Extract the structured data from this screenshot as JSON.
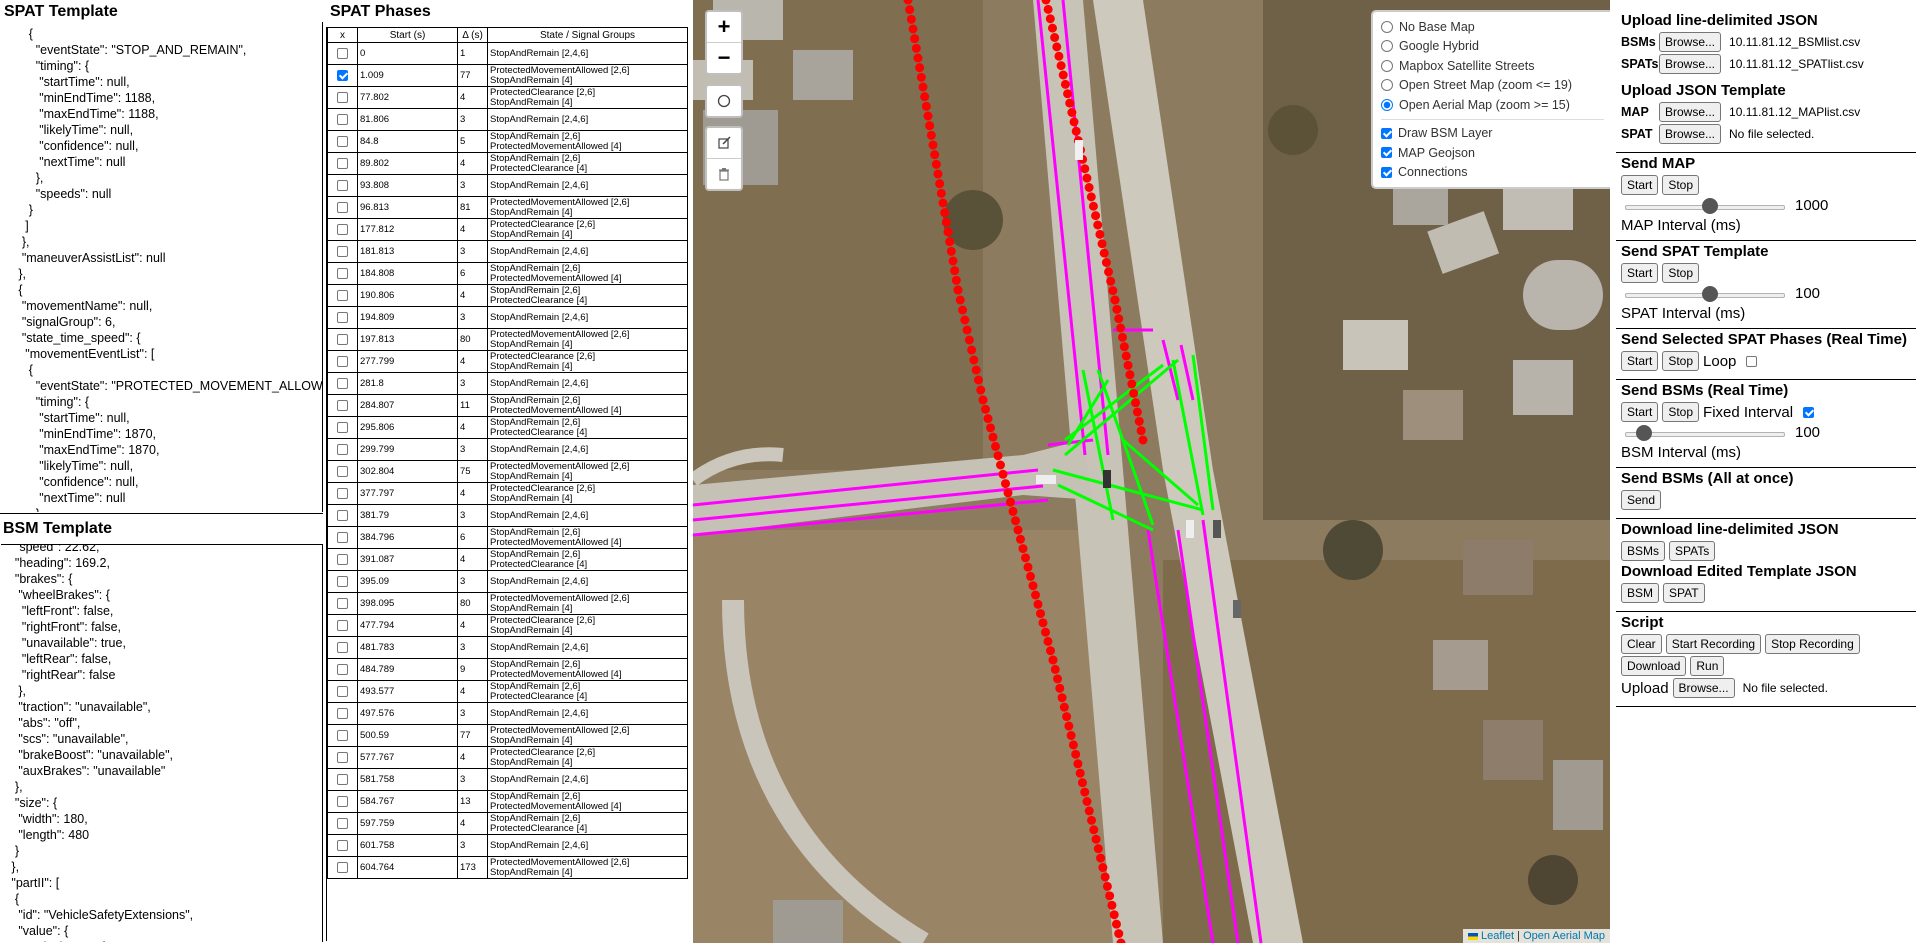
{
  "spat_template": {
    "title": "SPAT Template",
    "code": "        {\n          \"eventState\": \"STOP_AND_REMAIN\",\n          \"timing\": {\n           \"startTime\": null,\n           \"minEndTime\": 1188,\n           \"maxEndTime\": 1188,\n           \"likelyTime\": null,\n           \"confidence\": null,\n           \"nextTime\": null\n          },\n          \"speeds\": null\n        }\n       ]\n      },\n      \"maneuverAssistList\": null\n     },\n     {\n      \"movementName\": null,\n      \"signalGroup\": 6,\n      \"state_time_speed\": {\n       \"movementEventList\": [\n        {\n          \"eventState\": \"PROTECTED_MOVEMENT_ALLOWED\",\n          \"timing\": {\n           \"startTime\": null,\n           \"minEndTime\": 1870,\n           \"maxEndTime\": 1870,\n           \"likelyTime\": null,\n           \"confidence\": null,\n           \"nextTime\": null\n          },"
  },
  "bsm_template": {
    "title": "BSM Template",
    "code": "    \"speed\": 22.62,\n    \"heading\": 169.2,\n    \"brakes\": {\n     \"wheelBrakes\": {\n      \"leftFront\": false,\n      \"rightFront\": false,\n      \"unavailable\": true,\n      \"leftRear\": false,\n      \"rightRear\": false\n     },\n     \"traction\": \"unavailable\",\n     \"abs\": \"off\",\n     \"scs\": \"unavailable\",\n     \"brakeBoost\": \"unavailable\",\n     \"auxBrakes\": \"unavailable\"\n    },\n    \"size\": {\n     \"width\": 180,\n     \"length\": 480\n    }\n   },\n   \"partII\": [\n    {\n     \"id\": \"VehicleSafetyExtensions\",\n     \"value\": {\n      \"pathHistory\": {"
  },
  "spat_phases": {
    "title": "SPAT Phases",
    "headers": [
      "x",
      "Start (s)",
      "Δ (s)",
      "State / Signal Groups"
    ],
    "rows": [
      {
        "checked": false,
        "start": "0",
        "delta": "1",
        "state": "StopAndRemain [2,4,6]"
      },
      {
        "checked": true,
        "start": "1.009",
        "delta": "77",
        "state": "ProtectedMovementAllowed [2,6]\nStopAndRemain [4]"
      },
      {
        "checked": false,
        "start": "77.802",
        "delta": "4",
        "state": "ProtectedClearance [2,6]\nStopAndRemain [4]"
      },
      {
        "checked": false,
        "start": "81.806",
        "delta": "3",
        "state": "StopAndRemain [2,4,6]"
      },
      {
        "checked": false,
        "start": "84.8",
        "delta": "5",
        "state": "StopAndRemain [2,6]\nProtectedMovementAllowed [4]"
      },
      {
        "checked": false,
        "start": "89.802",
        "delta": "4",
        "state": "StopAndRemain [2,6]\nProtectedClearance [4]"
      },
      {
        "checked": false,
        "start": "93.808",
        "delta": "3",
        "state": "StopAndRemain [2,4,6]"
      },
      {
        "checked": false,
        "start": "96.813",
        "delta": "81",
        "state": "ProtectedMovementAllowed [2,6]\nStopAndRemain [4]"
      },
      {
        "checked": false,
        "start": "177.812",
        "delta": "4",
        "state": "ProtectedClearance [2,6]\nStopAndRemain [4]"
      },
      {
        "checked": false,
        "start": "181.813",
        "delta": "3",
        "state": "StopAndRemain [2,4,6]"
      },
      {
        "checked": false,
        "start": "184.808",
        "delta": "6",
        "state": "StopAndRemain [2,6]\nProtectedMovementAllowed [4]"
      },
      {
        "checked": false,
        "start": "190.806",
        "delta": "4",
        "state": "StopAndRemain [2,6]\nProtectedClearance [4]"
      },
      {
        "checked": false,
        "start": "194.809",
        "delta": "3",
        "state": "StopAndRemain [2,4,6]"
      },
      {
        "checked": false,
        "start": "197.813",
        "delta": "80",
        "state": "ProtectedMovementAllowed [2,6]\nStopAndRemain [4]"
      },
      {
        "checked": false,
        "start": "277.799",
        "delta": "4",
        "state": "ProtectedClearance [2,6]\nStopAndRemain [4]"
      },
      {
        "checked": false,
        "start": "281.8",
        "delta": "3",
        "state": "StopAndRemain [2,4,6]"
      },
      {
        "checked": false,
        "start": "284.807",
        "delta": "11",
        "state": "StopAndRemain [2,6]\nProtectedMovementAllowed [4]"
      },
      {
        "checked": false,
        "start": "295.806",
        "delta": "4",
        "state": "StopAndRemain [2,6]\nProtectedClearance [4]"
      },
      {
        "checked": false,
        "start": "299.799",
        "delta": "3",
        "state": "StopAndRemain [2,4,6]"
      },
      {
        "checked": false,
        "start": "302.804",
        "delta": "75",
        "state": "ProtectedMovementAllowed [2,6]\nStopAndRemain [4]"
      },
      {
        "checked": false,
        "start": "377.797",
        "delta": "4",
        "state": "ProtectedClearance [2,6]\nStopAndRemain [4]"
      },
      {
        "checked": false,
        "start": "381.79",
        "delta": "3",
        "state": "StopAndRemain [2,4,6]"
      },
      {
        "checked": false,
        "start": "384.796",
        "delta": "6",
        "state": "StopAndRemain [2,6]\nProtectedMovementAllowed [4]"
      },
      {
        "checked": false,
        "start": "391.087",
        "delta": "4",
        "state": "StopAndRemain [2,6]\nProtectedClearance [4]"
      },
      {
        "checked": false,
        "start": "395.09",
        "delta": "3",
        "state": "StopAndRemain [2,4,6]"
      },
      {
        "checked": false,
        "start": "398.095",
        "delta": "80",
        "state": "ProtectedMovementAllowed [2,6]\nStopAndRemain [4]"
      },
      {
        "checked": false,
        "start": "477.794",
        "delta": "4",
        "state": "ProtectedClearance [2,6]\nStopAndRemain [4]"
      },
      {
        "checked": false,
        "start": "481.783",
        "delta": "3",
        "state": "StopAndRemain [2,4,6]"
      },
      {
        "checked": false,
        "start": "484.789",
        "delta": "9",
        "state": "StopAndRemain [2,6]\nProtectedMovementAllowed [4]"
      },
      {
        "checked": false,
        "start": "493.577",
        "delta": "4",
        "state": "StopAndRemain [2,6]\nProtectedClearance [4]"
      },
      {
        "checked": false,
        "start": "497.576",
        "delta": "3",
        "state": "StopAndRemain [2,4,6]"
      },
      {
        "checked": false,
        "start": "500.59",
        "delta": "77",
        "state": "ProtectedMovementAllowed [2,6]\nStopAndRemain [4]"
      },
      {
        "checked": false,
        "start": "577.767",
        "delta": "4",
        "state": "ProtectedClearance [2,6]\nStopAndRemain [4]"
      },
      {
        "checked": false,
        "start": "581.758",
        "delta": "3",
        "state": "StopAndRemain [2,4,6]"
      },
      {
        "checked": false,
        "start": "584.767",
        "delta": "13",
        "state": "StopAndRemain [2,6]\nProtectedMovementAllowed [4]"
      },
      {
        "checked": false,
        "start": "597.759",
        "delta": "4",
        "state": "StopAndRemain [2,6]\nProtectedClearance [4]"
      },
      {
        "checked": false,
        "start": "601.758",
        "delta": "3",
        "state": "StopAndRemain [2,4,6]"
      },
      {
        "checked": false,
        "start": "604.764",
        "delta": "173",
        "state": "ProtectedMovementAllowed [2,6]\nStopAndRemain [4]"
      }
    ]
  },
  "map": {
    "zoom_in": "+",
    "zoom_out": "−",
    "base_layers": [
      {
        "label": "No Base Map",
        "selected": false
      },
      {
        "label": "Google Hybrid",
        "selected": false
      },
      {
        "label": "Mapbox Satellite Streets",
        "selected": false
      },
      {
        "label": "Open Street Map (zoom <= 19)",
        "selected": false
      },
      {
        "label": "Open Aerial Map (zoom >= 15)",
        "selected": true
      }
    ],
    "overlays": [
      {
        "label": "Draw BSM Layer",
        "checked": true
      },
      {
        "label": "MAP Geojson",
        "checked": true
      },
      {
        "label": "Connections",
        "checked": true
      }
    ],
    "attribution_leaflet": "Leaflet",
    "attribution_sep": " | ",
    "attribution_source": "Open Aerial Map",
    "colors": {
      "bsm": "#ff0000",
      "lanes": "#ff00ff",
      "connections": "#00ff00"
    }
  },
  "panel": {
    "upload_json": {
      "title": "Upload line-delimited JSON",
      "bsms_label": "BSMs",
      "bsms_file": "10.11.81.12_BSMlist.csv",
      "spats_label": "SPATs",
      "spats_file": "10.11.81.12_SPATlist.csv",
      "browse": "Browse..."
    },
    "upload_template": {
      "title": "Upload JSON Template",
      "map_label": "MAP",
      "map_file": "10.11.81.12_MAPlist.csv",
      "spat_label": "SPAT",
      "spat_file": "No file selected.",
      "browse": "Browse..."
    },
    "send_map": {
      "title": "Send MAP",
      "start": "Start",
      "stop": "Stop",
      "value": "1000",
      "value_pct": 53,
      "interval_label": "MAP Interval (ms)"
    },
    "send_spat_template": {
      "title": "Send SPAT Template",
      "start": "Start",
      "stop": "Stop",
      "value": "100",
      "value_pct": 53,
      "interval_label": "SPAT Interval (ms)"
    },
    "send_selected": {
      "title": "Send Selected SPAT Phases (Real Time)",
      "start": "Start",
      "stop": "Stop",
      "loop_label": "Loop",
      "loop_checked": false
    },
    "send_bsms_rt": {
      "title": "Send BSMs (Real Time)",
      "start": "Start",
      "stop": "Stop",
      "fixed_label": "Fixed Interval",
      "fixed_checked": true,
      "value": "100",
      "value_pct": 12,
      "interval_label": "BSM Interval (ms)"
    },
    "send_bsms_all": {
      "title": "Send BSMs (All at once)",
      "send": "Send"
    },
    "download_json": {
      "title": "Download line-delimited JSON",
      "bsms": "BSMs",
      "spats": "SPATs"
    },
    "download_template": {
      "title": "Download Edited Template JSON",
      "bsm": "BSM",
      "spat": "SPAT"
    },
    "script": {
      "title": "Script",
      "clear": "Clear",
      "start_recording": "Start Recording",
      "stop_recording": "Stop Recording",
      "download": "Download",
      "run": "Run",
      "upload_label": "Upload",
      "browse": "Browse...",
      "file": "No file selected."
    }
  }
}
